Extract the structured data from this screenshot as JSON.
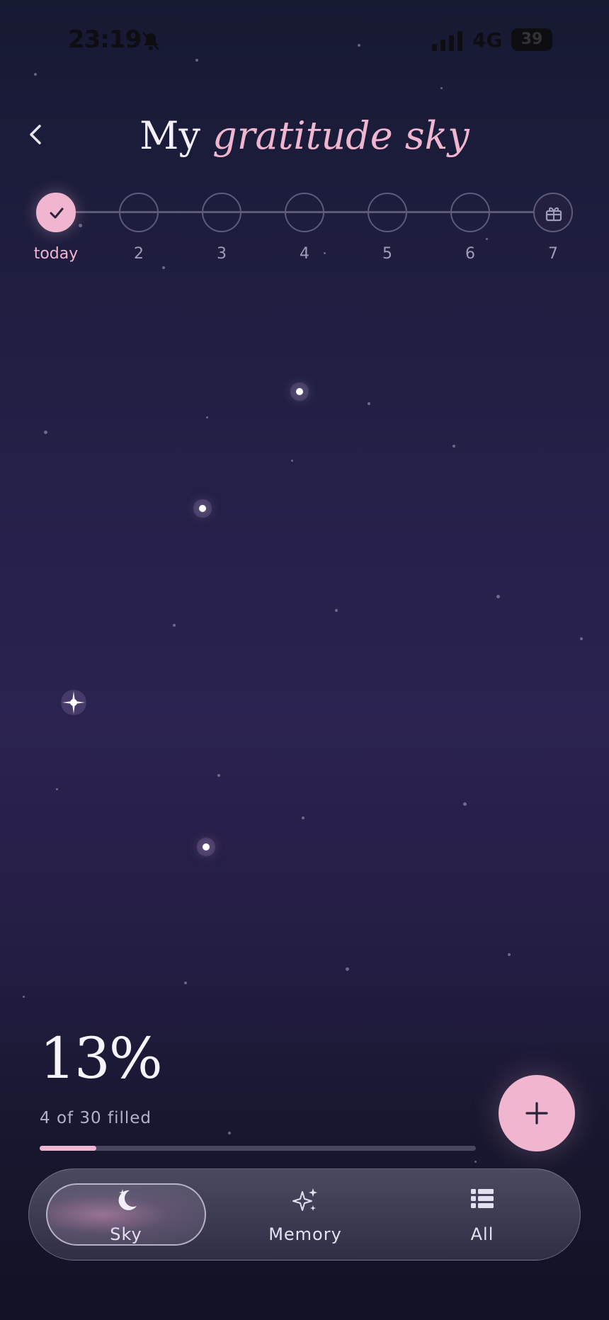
{
  "status_bar": {
    "time": "23:19",
    "network": "4G",
    "battery": "39"
  },
  "header": {
    "title_plain": "My",
    "title_accent": "gratitude sky",
    "back_icon": "chevron-left-icon"
  },
  "steps": [
    {
      "label": "today",
      "state": "done",
      "icon": "check-icon"
    },
    {
      "label": "2",
      "state": "empty"
    },
    {
      "label": "3",
      "state": "empty"
    },
    {
      "label": "4",
      "state": "empty"
    },
    {
      "label": "5",
      "state": "empty"
    },
    {
      "label": "6",
      "state": "empty"
    },
    {
      "label": "7",
      "state": "reward",
      "icon": "gift-icon"
    }
  ],
  "stats": {
    "percent": "13%",
    "filled_text": "4 of 30 filled",
    "progress_fraction": 0.13
  },
  "fab": {
    "icon": "plus-icon"
  },
  "nav": {
    "items": [
      {
        "label": "Sky",
        "icon": "moon-stars-icon",
        "active": true
      },
      {
        "label": "Memory",
        "icon": "sparkles-icon",
        "active": false
      },
      {
        "label": "All",
        "icon": "list-icon",
        "active": false
      }
    ]
  },
  "colors": {
    "accent": "#f0b6cf",
    "background_top": "#171a33",
    "background_mid": "#2b2250"
  }
}
